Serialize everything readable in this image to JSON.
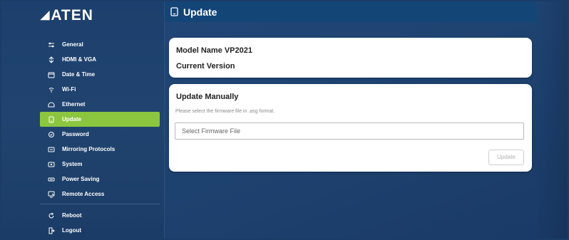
{
  "brand": {
    "logo_text": "ATEN"
  },
  "sidebar": {
    "items": [
      {
        "label": "General",
        "icon": "settings-sliders-icon"
      },
      {
        "label": "HDMI & VGA",
        "icon": "hdmi-icon"
      },
      {
        "label": "Date & Time",
        "icon": "calendar-icon"
      },
      {
        "label": "Wi-Fi",
        "icon": "wifi-icon"
      },
      {
        "label": "Ethernet",
        "icon": "ethernet-icon"
      },
      {
        "label": "Update",
        "icon": "update-icon",
        "active": true
      },
      {
        "label": "Password",
        "icon": "password-icon"
      },
      {
        "label": "Mirroring Protocols",
        "icon": "mirroring-icon"
      },
      {
        "label": "System",
        "icon": "system-icon"
      },
      {
        "label": "Power Saving",
        "icon": "power-saving-icon"
      },
      {
        "label": "Remote Access",
        "icon": "remote-access-icon"
      }
    ],
    "bottom_items": [
      {
        "label": "Reboot",
        "icon": "reboot-icon"
      },
      {
        "label": "Logout",
        "icon": "logout-icon"
      }
    ]
  },
  "header": {
    "title": "Update",
    "icon": "update-icon"
  },
  "info_card": {
    "model_label": "Model Name VP2021",
    "version_label": "Current Version"
  },
  "update_card": {
    "title": "Update Manually",
    "hint": "Please select the firmware file in .asg format.",
    "file_placeholder": "Select Firmware File",
    "button_label": "Update"
  },
  "colors": {
    "accent": "#8cc63f",
    "header_bg": "#134577",
    "background": "#1f4472"
  }
}
